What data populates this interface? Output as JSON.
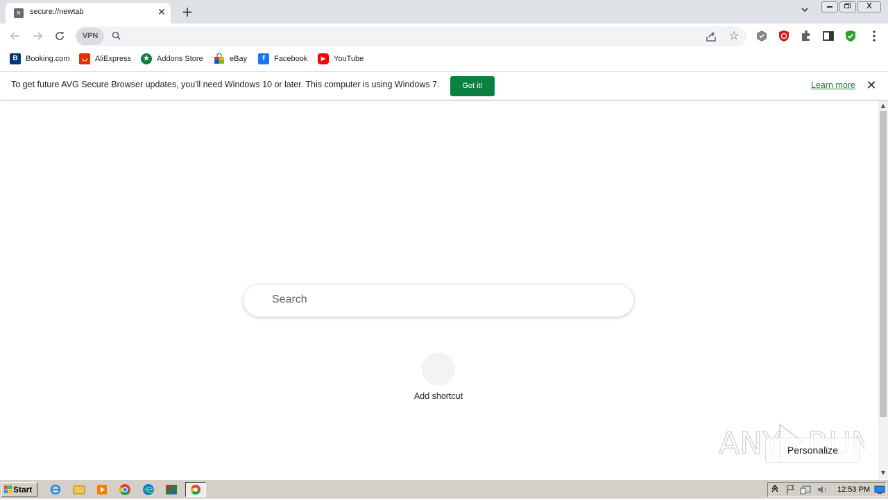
{
  "tab": {
    "favicon_letter": "N",
    "title": "secure://newtab"
  },
  "omnibox": {
    "vpn_label": "VPN",
    "placeholder": ""
  },
  "bookmarks": [
    {
      "label": "Booking.com",
      "icon": "booking-icon",
      "color": "#003580"
    },
    {
      "label": "AliExpress",
      "icon": "aliexpress-icon",
      "color": "#e62e04"
    },
    {
      "label": "Addons Store",
      "icon": "addons-store-icon",
      "color": "#0b8043"
    },
    {
      "label": "eBay",
      "icon": "ebay-icon",
      "color": "#e53238"
    },
    {
      "label": "Facebook",
      "icon": "facebook-icon",
      "color": "#1877f2"
    },
    {
      "label": "YouTube",
      "icon": "youtube-icon",
      "color": "#ff0000"
    }
  ],
  "infobar": {
    "message": "To get future AVG Secure Browser updates, you'll need Windows 10 or later. This computer is using Windows 7.",
    "button_label": "Got it!",
    "link_label": "Learn more"
  },
  "ntp": {
    "search_placeholder": "Search",
    "shortcut_label": "Add shortcut",
    "personalize_label": "Personalize"
  },
  "taskbar": {
    "start_label": "Start",
    "clock": "12:53 PM"
  },
  "colors": {
    "accent_green": "#0b8043",
    "link_green": "#188038",
    "tabstrip_bg": "#dee1e6"
  }
}
